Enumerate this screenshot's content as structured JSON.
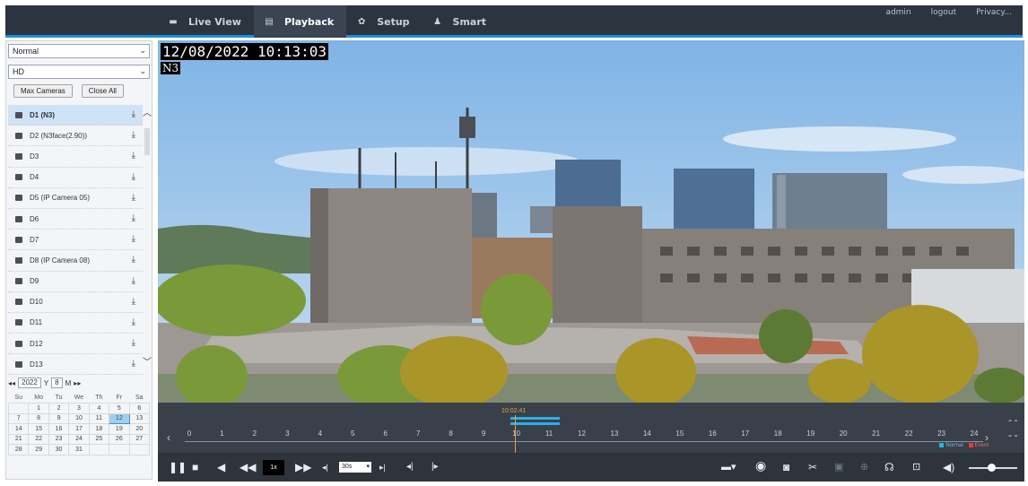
{
  "nav": {
    "items": [
      {
        "label": "Live View",
        "icon": "monitor-icon"
      },
      {
        "label": "Playback",
        "icon": "playback-icon"
      },
      {
        "label": "Setup",
        "icon": "gear-icon"
      },
      {
        "label": "Smart",
        "icon": "person-icon"
      }
    ],
    "active": "Playback",
    "user": "admin",
    "logout": "logout",
    "privacy": "Privacy..."
  },
  "left": {
    "mode_value": "Normal",
    "stream_value": "HD",
    "max_cameras": "Max Cameras",
    "close_all": "Close All",
    "cameras": [
      "D1 (N3)",
      "D2 (N3face(2.90))",
      "D3",
      "D4",
      "D5 (IP Camera 05)",
      "D6",
      "D7",
      "D8 (IP Camera 08)",
      "D9",
      "D10",
      "D11",
      "D12",
      "D13"
    ],
    "selected_camera": "D1 (N3)",
    "date": {
      "year": "2022",
      "year_label": "Y",
      "month": "8",
      "month_label": "M"
    },
    "calendar": {
      "weekdays": [
        "Su",
        "Mo",
        "Tu",
        "We",
        "Th",
        "Fr",
        "Sa"
      ],
      "weeks": [
        [
          "",
          "1",
          "2",
          "3",
          "4",
          "5",
          "6"
        ],
        [
          "7",
          "8",
          "9",
          "10",
          "11",
          "12",
          "13"
        ],
        [
          "14",
          "15",
          "16",
          "17",
          "18",
          "19",
          "20"
        ],
        [
          "21",
          "22",
          "23",
          "24",
          "25",
          "26",
          "27"
        ],
        [
          "28",
          "29",
          "30",
          "31",
          "",
          "",
          ""
        ]
      ],
      "selected_day": "12"
    }
  },
  "video": {
    "timestamp": "12/08/2022 10:13:03",
    "channel": "N3"
  },
  "timeline": {
    "cursor_time": "10:02:41",
    "hours": [
      "0",
      "1",
      "2",
      "3",
      "4",
      "5",
      "6",
      "7",
      "8",
      "9",
      "10",
      "11",
      "12",
      "13",
      "14",
      "15",
      "16",
      "17",
      "18",
      "19",
      "20",
      "21",
      "22",
      "23",
      "24"
    ],
    "legend": [
      {
        "label": "Normal",
        "color": "#2bb0e8"
      },
      {
        "label": "Event",
        "color": "#e23b3b"
      }
    ]
  },
  "controls": {
    "speed": "1x",
    "interval": "30s"
  },
  "colors": {
    "accent": "#1f8fd6",
    "topbar": "#2c3440",
    "timeline_cursor": "#e2a34a",
    "recording": "#2bb0e8"
  }
}
